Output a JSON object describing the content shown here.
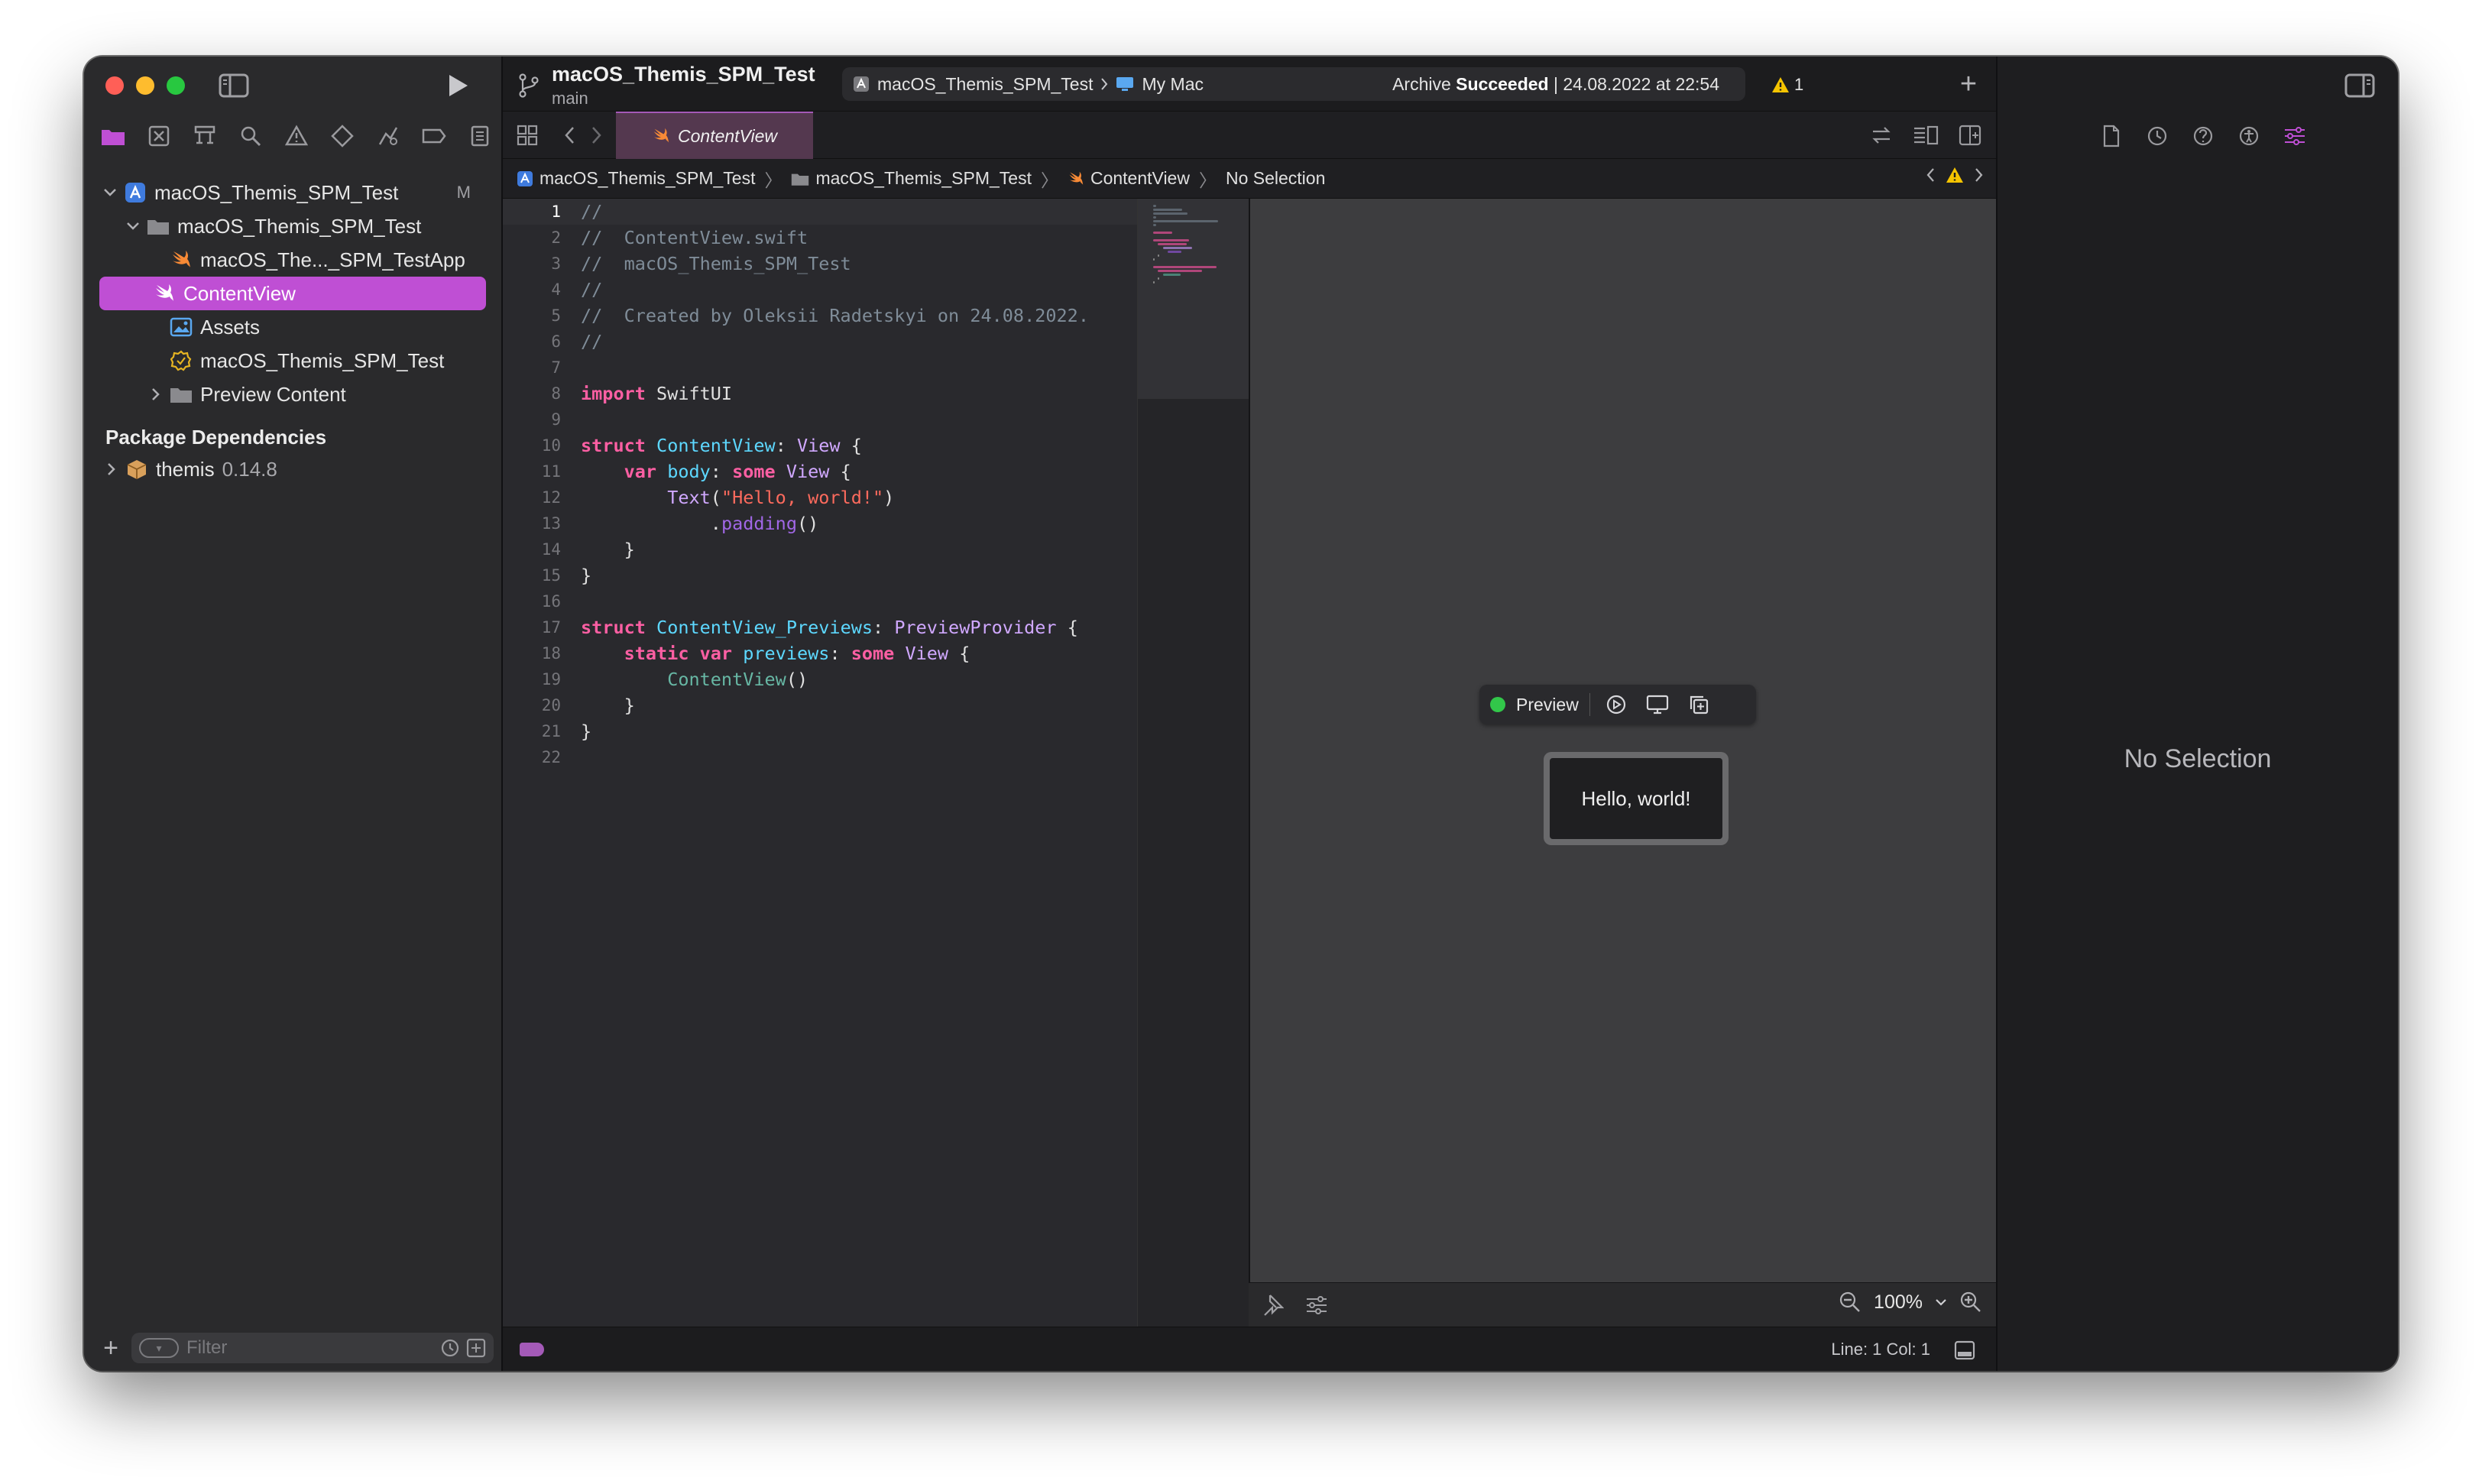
{
  "sidebar": {
    "tree": [
      {
        "label": "macOS_Themis_SPM_Test",
        "icon": "app-project-icon",
        "indent": 0,
        "expanded": true,
        "badge": "M"
      },
      {
        "label": "macOS_Themis_SPM_Test",
        "icon": "folder-icon",
        "indent": 1,
        "expanded": true
      },
      {
        "label": "macOS_The..._SPM_TestApp",
        "icon": "swift-file-icon",
        "indent": 2
      },
      {
        "label": "ContentView",
        "icon": "swift-file-icon",
        "indent": 2,
        "selected": true
      },
      {
        "label": "Assets",
        "icon": "asset-catalog-icon",
        "indent": 2
      },
      {
        "label": "macOS_Themis_SPM_Test",
        "icon": "entitlements-icon",
        "indent": 2
      },
      {
        "label": "Preview Content",
        "icon": "folder-icon",
        "indent": 2,
        "expanded": false
      }
    ],
    "section_title": "Package Dependencies",
    "package": {
      "name": "themis",
      "version": "0.14.8"
    },
    "filter_placeholder": "Filter"
  },
  "toolbar": {
    "project": "macOS_Themis_SPM_Test",
    "branch": "main",
    "scheme": "macOS_Themis_SPM_Test",
    "destination": "My Mac",
    "status_prefix": "Archive",
    "status_bold": "Succeeded",
    "status_suffix": "| 24.08.2022 at 22:54",
    "warning_count": "1"
  },
  "tab": {
    "label": "ContentView"
  },
  "jumpbar": {
    "items": [
      "macOS_Themis_SPM_Test",
      "macOS_Themis_SPM_Test",
      "ContentView",
      "No Selection"
    ]
  },
  "editor": {
    "current_line": 1,
    "lines": [
      "<span class=\"cm\">//</span>",
      "<span class=\"cm\">//  ContentView.swift</span>",
      "<span class=\"cm\">//  macOS_Themis_SPM_Test</span>",
      "<span class=\"cm\">//</span>",
      "<span class=\"cm\">//  Created by Oleksii Radetskyi on 24.08.2022.</span>",
      "<span class=\"cm\">//</span>",
      "",
      "<span class=\"kw\">import</span> SwiftUI",
      "",
      "<span class=\"kw\">struct</span> <span class=\"dt\">ContentView</span>: <span class=\"ty\">View</span> {",
      "    <span class=\"kw\">var</span> <span class=\"dt\">body</span>: <span class=\"kw\">some</span> <span class=\"ty\">View</span> {",
      "        <span class=\"ty\">Text</span>(<span class=\"st\">\"Hello, world!\"</span>)",
      "            .<span class=\"pm\">padding</span>()",
      "    }",
      "}",
      "",
      "<span class=\"kw\">struct</span> <span class=\"dt\">ContentView_Previews</span>: <span class=\"ty\">PreviewProvider</span> {",
      "    <span class=\"kw\">static</span> <span class=\"kw\">var</span> <span class=\"dt\">previews</span>: <span class=\"kw\">some</span> <span class=\"ty\">View</span> {",
      "        <span class=\"fn\">ContentView</span>()",
      "    }",
      "}",
      ""
    ]
  },
  "preview": {
    "label": "Preview",
    "hello_text": "Hello, world!",
    "zoom": "100%"
  },
  "status": {
    "line_col": "Line: 1  Col: 1"
  },
  "inspector": {
    "no_selection": "No Selection"
  },
  "colors": {
    "accent": "#bf4fd4",
    "live": "#32c74a",
    "warning": "#f5c400"
  }
}
